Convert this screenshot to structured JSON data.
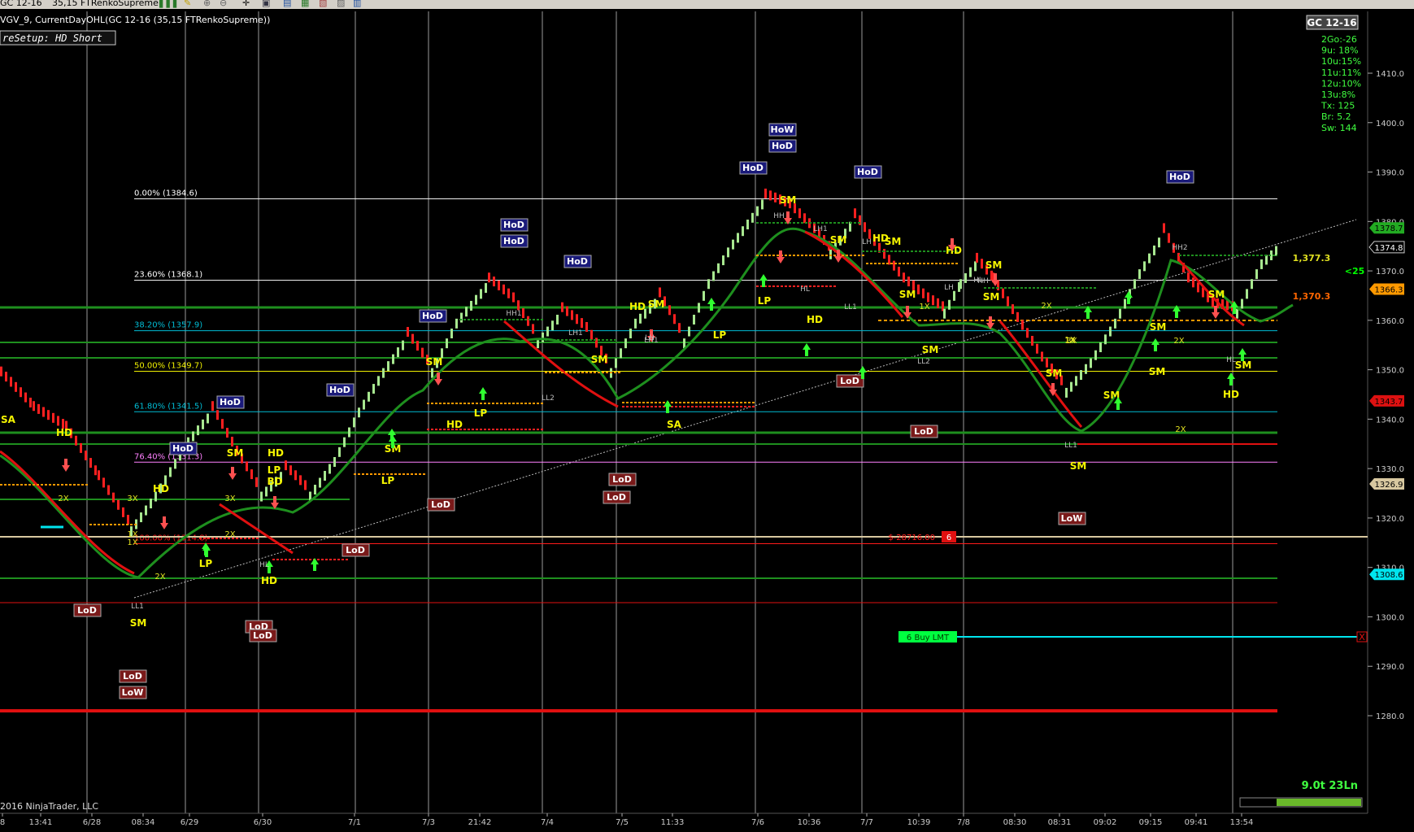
{
  "toolbar": {
    "instrument": "GC 12-16",
    "bartype": "35,15 FTRenkoSupreme",
    "icons": [
      "bars-icon",
      "draw-icon",
      "zoom-in-icon",
      "zoom-out-icon",
      "crosshair-icon",
      "properties-icon",
      "data-box-icon",
      "indicators-icon",
      "strategies-icon",
      "print-icon",
      "share-icon"
    ]
  },
  "chart": {
    "header_title": "VGV_9, CurrentDayOHL(GC 12-16 (35,15 FTRenkoSupreme))",
    "setup_label": "reSetup: HD Short",
    "instrument_badge": "GC 12-16",
    "copyright": "2016 NinjaTrader, LLC",
    "renko_info": "9.0t 23Ln",
    "stats": [
      "2Go:-26",
      "9u: 18%",
      "10u:15%",
      "11u:11%",
      "12u:10%",
      "13u:8%",
      "Tx: 125",
      "Br: 5.2",
      "Sw: 144"
    ],
    "colors": {
      "up_bar": "#a8e890",
      "down_bar": "#ff2020",
      "fib": "#ffffff",
      "green_line": "#1e8f1e",
      "red_line": "#e01010",
      "label_box": "#1a1a7a",
      "lod_box": "#8b1a1a",
      "orange": "#ff9900",
      "buy_lmt": "#00ff40",
      "cyan": "#00e5ee"
    }
  },
  "price_axis": {
    "ticks": [
      "1410.0",
      "1400.0",
      "1390.0",
      "1380.0",
      "1370.0",
      "1360.0",
      "1350.0",
      "1340.0",
      "1330.0",
      "1320.0",
      "1310.0",
      "1300.0",
      "1290.0",
      "1280.0"
    ],
    "last_price": "1374.8",
    "markers": [
      {
        "text": "1378.7",
        "color": "#22aa22"
      },
      {
        "text": "1366.3",
        "color": "#ff9900"
      },
      {
        "text": "1343.7",
        "color": "#dd1111"
      },
      {
        "text": "1326.9",
        "color": "#d8c8a0"
      },
      {
        "text": "1308.6",
        "color": "#00e5ee"
      }
    ],
    "plot_labels": [
      {
        "text": "1,377.3",
        "color": "#e0e020"
      },
      {
        "text": "1,370.3",
        "color": "#ff6600"
      },
      {
        "text": "<25",
        "color": "#00ff00"
      }
    ]
  },
  "time_axis": {
    "labels": [
      "8",
      "13:41",
      "6/28",
      "08:34",
      "6/29",
      "6/30",
      "7/1",
      "7/3",
      "21:42",
      "7/4",
      "7/5",
      "11:33",
      "7/6",
      "10:36",
      "7/7",
      "10:39",
      "7/8",
      "08:30",
      "08:31",
      "09:02",
      "09:15",
      "09:41",
      "13:54"
    ]
  },
  "fib_levels": [
    {
      "label": "0.00% (1384.6)"
    },
    {
      "label": "23.60% (1368.1)"
    },
    {
      "label": "38.20% (1357.9)"
    },
    {
      "label": "50.00% (1349.7)"
    },
    {
      "label": "61.80% (1341.5)"
    },
    {
      "label": "76.40% (1331.3)"
    },
    {
      "label": "100.00% (1314.8)"
    }
  ],
  "orders": {
    "buy_lmt_label": "6  Buy LMT",
    "position_pnl": "$-28716.00",
    "position_qty": "6",
    "close_icon": "X"
  },
  "day_labels": [
    {
      "text": "HoW"
    },
    {
      "text": "HoD"
    },
    {
      "text": "HoD"
    },
    {
      "text": "HoD"
    },
    {
      "text": "HoD"
    },
    {
      "text": "HoD"
    },
    {
      "text": "HoD"
    },
    {
      "text": "HoD"
    },
    {
      "text": "HoW"
    },
    {
      "text": "HoD"
    },
    {
      "text": "HoD"
    },
    {
      "text": "HoD"
    },
    {
      "text": "HoD"
    },
    {
      "text": "LoD"
    },
    {
      "text": "LoD"
    },
    {
      "text": "LoD"
    },
    {
      "text": "LoD"
    },
    {
      "text": "LoD"
    },
    {
      "text": "LoD"
    },
    {
      "text": "LoD"
    },
    {
      "text": "LoD"
    },
    {
      "text": "LoD"
    },
    {
      "text": "LoW"
    },
    {
      "text": "LoD"
    },
    {
      "text": "LoW"
    }
  ],
  "signals": [
    "SM",
    "SM",
    "SM",
    "SM",
    "SM",
    "SM",
    "SM",
    "SM",
    "SM",
    "SM",
    "SM",
    "SM",
    "SM",
    "SM",
    "SM",
    "SM",
    "SM",
    "SM",
    "SM",
    "SM",
    "HD",
    "HD",
    "HD",
    "HD",
    "HD",
    "HD",
    "HD",
    "HD",
    "HD",
    "HD",
    "LP",
    "LP",
    "LP",
    "LP",
    "LP",
    "LP",
    "SA",
    "SA",
    "BD"
  ],
  "swing_labels": [
    "HH1",
    "LH1",
    "LH1",
    "HH",
    "LH1",
    "LH",
    "LL2",
    "LL1",
    "LL2",
    "LL1",
    "HL",
    "HL",
    "HL",
    "HL",
    "HH2",
    "LL1",
    "LH",
    "LH",
    "HH"
  ],
  "multipliers": [
    "3X",
    "2X",
    "1X",
    "3X",
    "2X",
    "1X",
    "2X",
    "3X",
    "1X",
    "2X",
    "2X",
    "1X",
    "1X",
    "2X"
  ]
}
